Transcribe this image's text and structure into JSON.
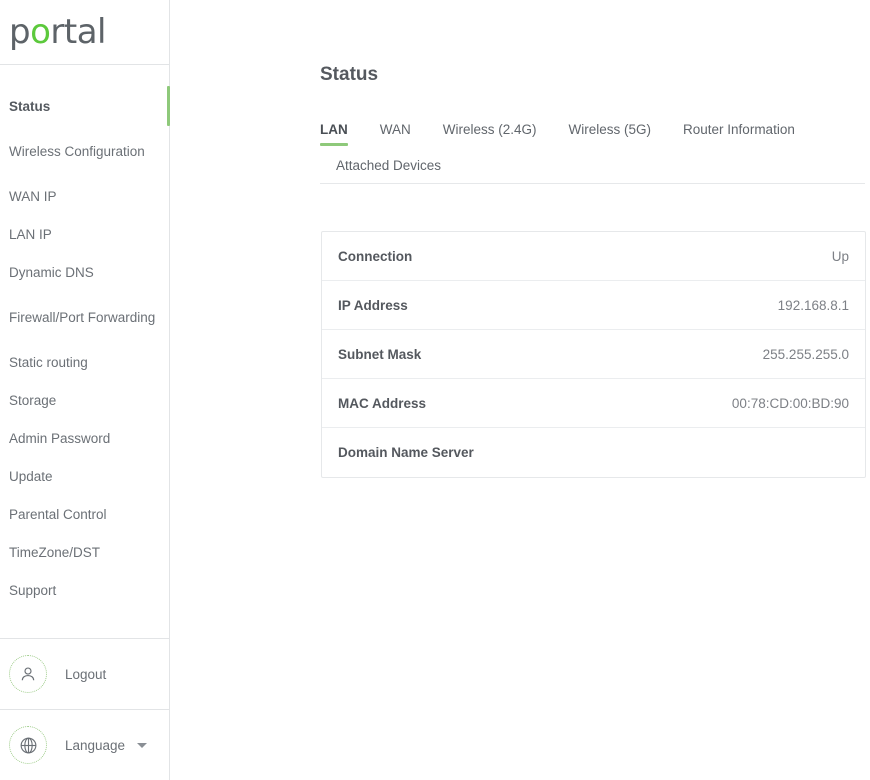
{
  "brand": {
    "text_before": "p",
    "accent_letter": "o",
    "text_after": "rtal",
    "accent_color": "#5cc93c"
  },
  "sidebar": {
    "items": [
      {
        "label": "Status",
        "active": true
      },
      {
        "label": "Wireless Configuration",
        "active": false
      },
      {
        "label": "WAN IP",
        "active": false
      },
      {
        "label": "LAN IP",
        "active": false
      },
      {
        "label": "Dynamic DNS",
        "active": false
      },
      {
        "label": "Firewall/Port Forwarding",
        "active": false
      },
      {
        "label": "Static routing",
        "active": false
      },
      {
        "label": "Storage",
        "active": false
      },
      {
        "label": "Admin Password",
        "active": false
      },
      {
        "label": "Update",
        "active": false
      },
      {
        "label": "Parental Control",
        "active": false
      },
      {
        "label": "TimeZone/DST",
        "active": false
      },
      {
        "label": "Support",
        "active": false
      }
    ],
    "logout": {
      "label": "Logout",
      "icon": "user-icon"
    },
    "language": {
      "label": "Language",
      "icon": "globe-icon",
      "caret": "chevron-down-icon"
    },
    "active_indicator_color": "#8ec97a"
  },
  "main": {
    "title": "Status",
    "tabs_row1": [
      {
        "label": "LAN",
        "active": true
      },
      {
        "label": "WAN",
        "active": false
      },
      {
        "label": "Wireless (2.4G)",
        "active": false
      },
      {
        "label": "Wireless (5G)",
        "active": false
      },
      {
        "label": "Router Information",
        "active": false
      }
    ],
    "tabs_row2": [
      {
        "label": "Attached Devices",
        "active": false
      }
    ],
    "active_tab_color": "#8ec97a",
    "table": [
      {
        "key": "Connection",
        "value": "Up"
      },
      {
        "key": "IP Address",
        "value": "192.168.8.1"
      },
      {
        "key": "Subnet Mask",
        "value": "255.255.255.0"
      },
      {
        "key": "MAC Address",
        "value": "00:78:CD:00:BD:90"
      },
      {
        "key": "Domain Name Server",
        "value": ""
      }
    ]
  }
}
